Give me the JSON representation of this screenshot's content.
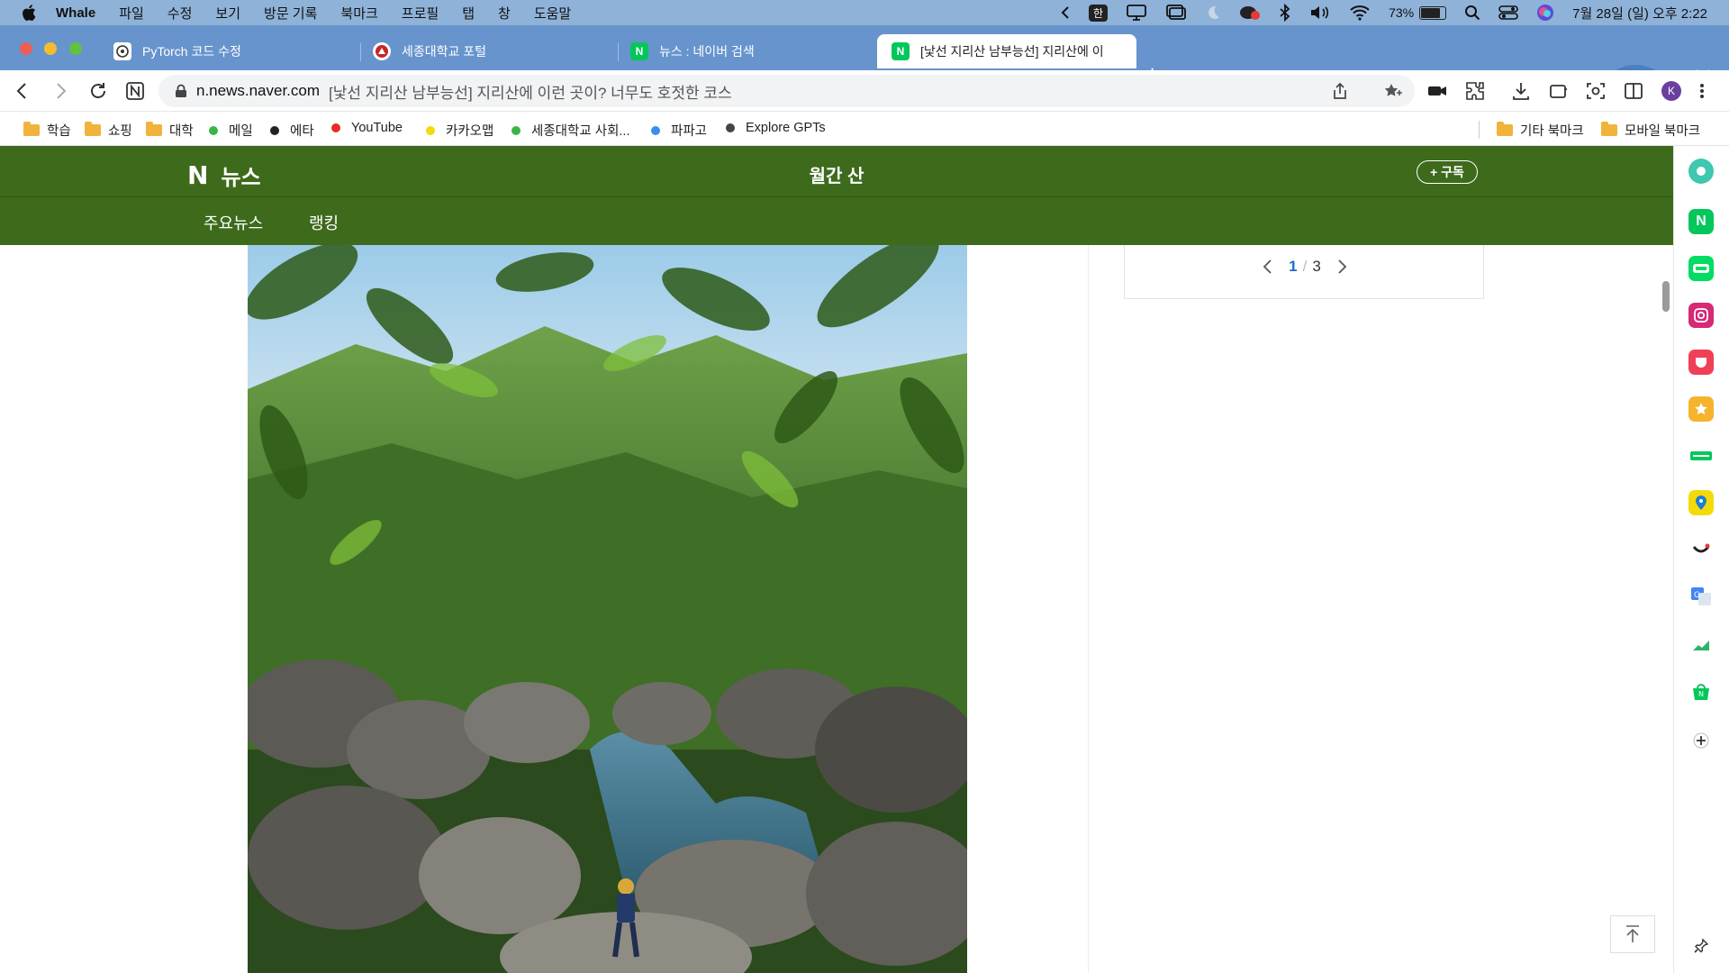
{
  "menubar": {
    "app_name": "Whale",
    "items": [
      "파일",
      "수정",
      "보기",
      "방문 기록",
      "북마크",
      "프로필",
      "탭",
      "창",
      "도움말"
    ],
    "ime_label": "한",
    "battery_percent": "73%",
    "battery_level": 0.73,
    "clock": "7월 28일 (일) 오후 2:22"
  },
  "tabs": [
    {
      "title": "PyTorch 코드 수정",
      "icon": "openai-icon",
      "active": false
    },
    {
      "title": "세종대학교 포털",
      "icon": "sejong-icon",
      "active": false
    },
    {
      "title": "뉴스 : 네이버 검색",
      "icon": "naver-icon",
      "active": false
    },
    {
      "title": "[낯선 지리산 남부능선] 지리산에 이",
      "icon": "naver-icon",
      "active": true
    }
  ],
  "toolbar": {
    "url_domain": "n.news.naver.com",
    "url_title": "[낯선 지리산 남부능선] 지리산에 이런 곳이? 너무도 호젓한 코스",
    "profile_initial": "K"
  },
  "bookmarks": {
    "left": [
      {
        "label": "학습",
        "type": "folder"
      },
      {
        "label": "쇼핑",
        "type": "folder"
      },
      {
        "label": "대학",
        "type": "folder"
      },
      {
        "label": "메일",
        "type": "dot",
        "color": "#3cb44b"
      },
      {
        "label": "에타",
        "type": "dot",
        "color": "#222222"
      },
      {
        "label": "YouTube",
        "type": "dot",
        "color": "#e52d27"
      },
      {
        "label": "카카오맵",
        "type": "dot",
        "color": "#f5d90a"
      },
      {
        "label": "세종대학교 사회...",
        "type": "dot",
        "color": "#3cb44b"
      },
      {
        "label": "파파고",
        "type": "dot",
        "color": "#3a8fe8"
      },
      {
        "label": "Explore GPTs",
        "type": "dot",
        "color": "#444444"
      }
    ],
    "right": [
      {
        "label": "기타 북마크",
        "type": "folder"
      },
      {
        "label": "모바일 북마크",
        "type": "folder"
      }
    ]
  },
  "news": {
    "logo_mark": "N",
    "logo_text": "뉴스",
    "press_name": "월간 산",
    "subscribe_label": "+ 구독",
    "nav": [
      "주요뉴스",
      "랭킹"
    ],
    "brand_color": "#3e6a1c"
  },
  "pager": {
    "current": "1",
    "separator": "/",
    "total": "3"
  },
  "sidebar_icons": [
    "whale-space-icon",
    "naver-icon",
    "webtoon-icon",
    "instagram-icon",
    "pocket-icon",
    "favorites-icon",
    "wallet-icon",
    "map-pin-icon",
    "smile-icon",
    "translate-icon",
    "stocks-icon",
    "naver-shopping-icon",
    "add-icon",
    "pin-icon"
  ]
}
